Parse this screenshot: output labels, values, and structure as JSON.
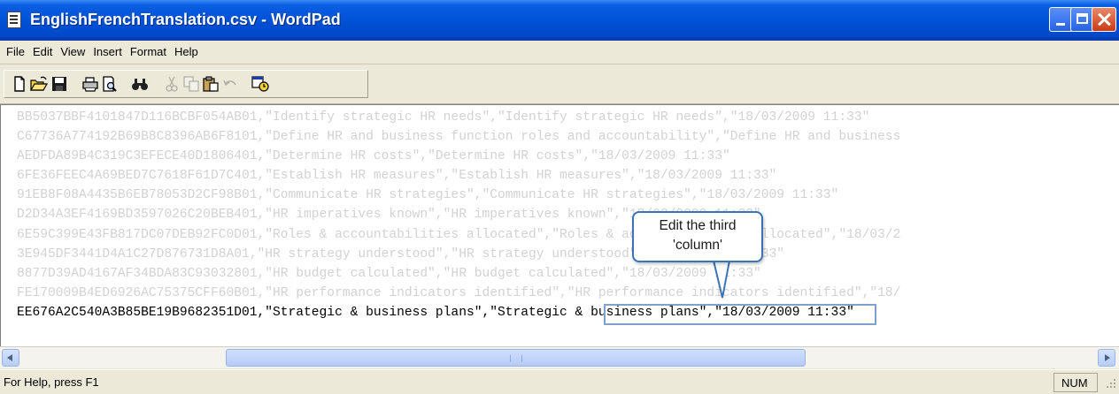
{
  "window": {
    "title": "EnglishFrenchTranslation.csv - WordPad"
  },
  "menu": [
    "File",
    "Edit",
    "View",
    "Insert",
    "Format",
    "Help"
  ],
  "toolbar": {
    "tools": [
      "new-icon",
      "open-icon",
      "save-icon",
      "print-icon",
      "print-preview-icon",
      "find-icon",
      "cut-icon",
      "copy-icon",
      "paste-icon",
      "undo-icon",
      "date-time-icon"
    ]
  },
  "document": {
    "lines": [
      "BB5037BBF4101847D116BCBF054AB01,\"Identify strategic HR needs\",\"Identify strategic HR needs\",\"18/03/2009 11:33\"",
      "C67736A774192B69B8C8396AB6F8101,\"Define HR and business function roles and accountability\",\"Define HR and business",
      "AEDFDA89B4C319C3EFECE40D1806401,\"Determine HR costs\",\"Determine HR costs\",\"18/03/2009 11:33\"",
      "6FE36FEEC4A69BED7C7618F61D7C401,\"Establish HR measures\",\"Establish HR measures\",\"18/03/2009 11:33\"",
      "91EB8F08A4435B6EB78053D2CF98B01,\"Communicate HR strategies\",\"Communicate HR strategies\",\"18/03/2009 11:33\"",
      "D2D34A3EF4169BD3597026C20BEB401,\"HR imperatives known\",\"HR imperatives known\",\"18/03/2009 11:33\"",
      "6E59C399E43FB817DC07DEB92FC0D01,\"Roles & accountabilities allocated\",\"Roles & accountabilities allocated\",\"18/03/2",
      "3E945DF3441D4A1C27D876731D8A01,\"HR strategy understood\",\"HR strategy understood\",\"18/03/2009 11:33\"",
      "8877D39AD4167AF34BDA83C93032801,\"HR budget calculated\",\"HR budget calculated\",\"18/03/2009 11:33\"",
      "FE170009B4ED6926AC75375CFF60B01,\"HR performance indicators identified\",\"HR performance indicators identified\",\"18/"
    ],
    "active_line": "EE676A2C540A3B85BE19B9682351D01,\"Strategic & business plans\",\"Strategic & business plans\",\"18/03/2009 11:33\"",
    "highlighted": "\"Strategic & business plans\""
  },
  "callout": {
    "line1": "Edit the third",
    "line2": "'column'"
  },
  "statusbar": {
    "help": "For Help, press F1",
    "num": "NUM"
  }
}
